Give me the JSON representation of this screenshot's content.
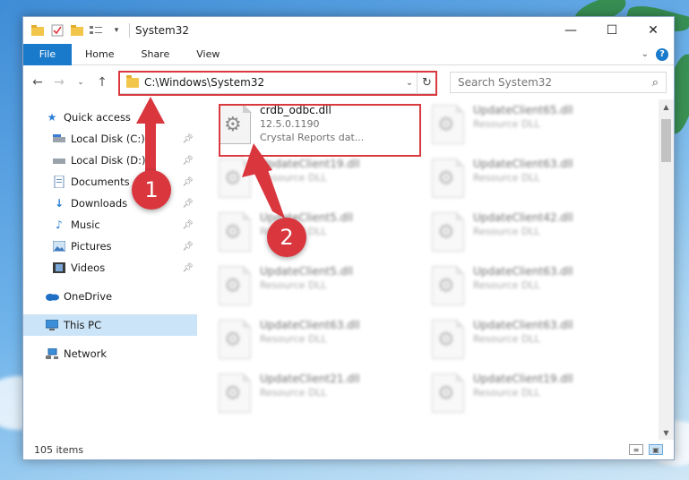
{
  "window": {
    "title": "System32",
    "minimize_glyph": "—",
    "maximize_glyph": "☐",
    "close_glyph": "✕"
  },
  "ribbon": {
    "file": "File",
    "tabs": [
      "Home",
      "Share",
      "View"
    ],
    "help_glyph": "?"
  },
  "address_bar": {
    "path": "C:\\Windows\\System32",
    "dropdown_glyph": "⌄",
    "refresh_glyph": "↻"
  },
  "search": {
    "placeholder": "Search System32"
  },
  "sidebar": {
    "quick_access": "Quick access",
    "items": [
      {
        "label": "Local Disk (C:)",
        "icon": "drive-icon"
      },
      {
        "label": "Local Disk (D:)",
        "icon": "drive-icon"
      },
      {
        "label": "Documents",
        "icon": "documents-icon"
      },
      {
        "label": "Downloads",
        "icon": "downloads-icon"
      },
      {
        "label": "Music",
        "icon": "music-icon"
      },
      {
        "label": "Pictures",
        "icon": "pictures-icon"
      },
      {
        "label": "Videos",
        "icon": "videos-icon"
      }
    ],
    "onedrive": "OneDrive",
    "this_pc": "This PC",
    "network": "Network"
  },
  "files": {
    "highlighted": {
      "name": "crdb_odbc.dll",
      "version": "12.5.0.1190",
      "description": "Crystal Reports dat..."
    },
    "blurred": [
      {
        "name": "UpdateClient65.dll",
        "type": "Resource DLL"
      },
      {
        "name": "UpdateClient19.dll",
        "type": "Resource DLL"
      },
      {
        "name": "UpdateClient63.dll",
        "type": "Resource DLL"
      },
      {
        "name": "UpdateClient5.dll",
        "type": "Resource DLL"
      },
      {
        "name": "UpdateClient42.dll",
        "type": "Resource DLL"
      },
      {
        "name": "UpdateClient5.dll",
        "type": "Resource DLL"
      },
      {
        "name": "UpdateClient63.dll",
        "type": "Resource DLL"
      },
      {
        "name": "UpdateClient63.dll",
        "type": "Resource DLL"
      },
      {
        "name": "UpdateClient63.dll",
        "type": "Resource DLL"
      },
      {
        "name": "UpdateClient21.dll",
        "type": "Resource DLL"
      },
      {
        "name": "UpdateClient19.dll",
        "type": "Resource DLL"
      }
    ]
  },
  "status": {
    "item_count": "105 items"
  },
  "annotations": {
    "step1": "1",
    "step2": "2",
    "color": "#d9363e"
  }
}
